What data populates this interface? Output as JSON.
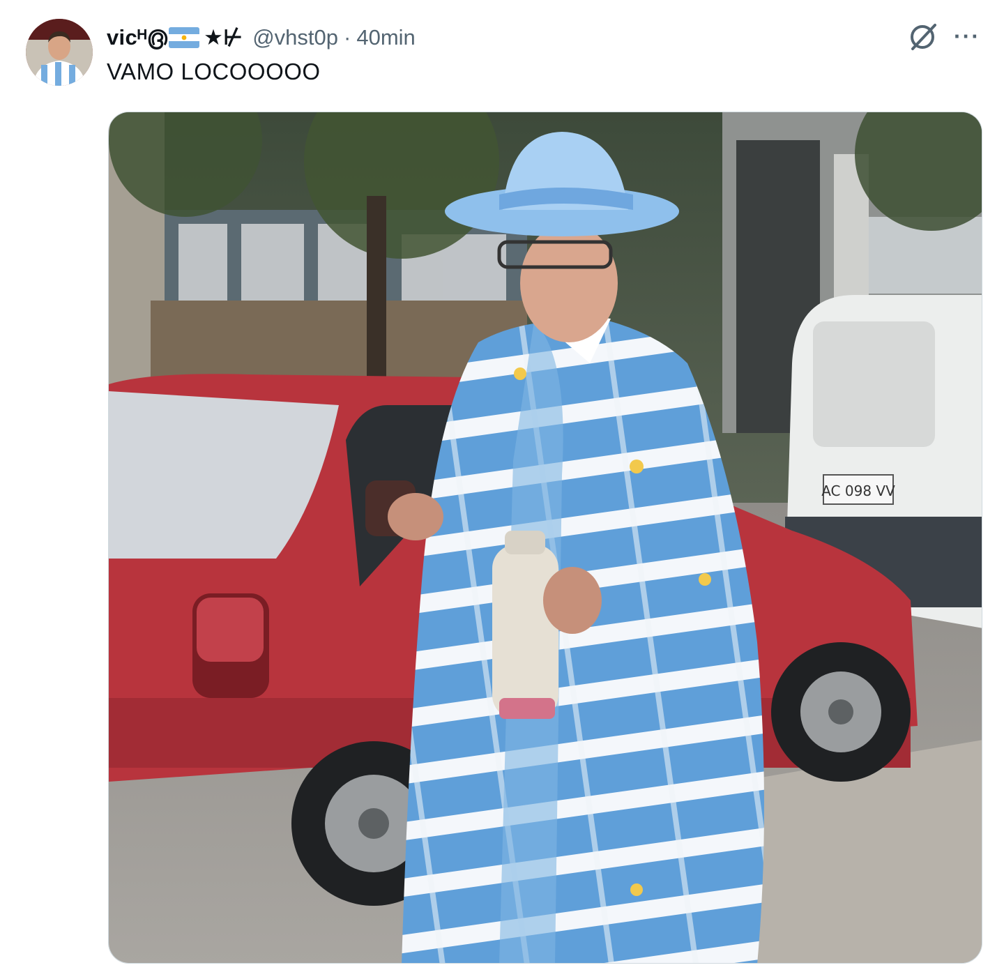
{
  "tweet": {
    "display_name": "vicᴴ൫",
    "name_flag_icon": "argentina-flag-icon",
    "name_suffix": "★⊬",
    "handle": "@vhst0p",
    "separator": "·",
    "timestamp": "40min",
    "text": "VAMO LOCOOOOO",
    "media": {
      "kind": "photo",
      "plate_text": "AC 098 VV"
    }
  },
  "icons": {
    "grok": "grok-icon",
    "more": "more-options-icon",
    "more_glyph": "···"
  },
  "colors": {
    "text_primary": "#0f1419",
    "text_secondary": "#536471",
    "flag_blue": "#74acdf",
    "border": "#cfd9de"
  }
}
